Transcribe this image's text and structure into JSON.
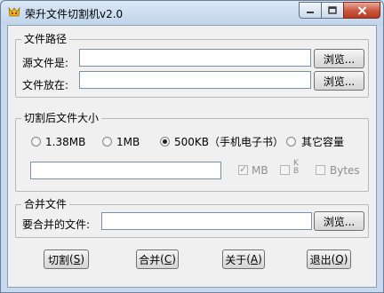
{
  "window": {
    "title": "荣升文件切割机v2.0"
  },
  "file_path": {
    "group_label": "文件路径",
    "source_label": "源文件是:",
    "source_value": "",
    "dest_label": "文件放在:",
    "dest_value": "",
    "browse_label": "浏览..."
  },
  "size": {
    "group_label": "切割后文件大小",
    "options": [
      {
        "label": "1.38MB",
        "checked": false
      },
      {
        "label": "1MB",
        "checked": false
      },
      {
        "label": "500KB（手机电子书）",
        "checked": true
      },
      {
        "label": "其它容量",
        "checked": false
      }
    ],
    "custom_value": "",
    "unit_mb": {
      "label": "MB",
      "checked": true
    },
    "unit_k": {
      "label": "K",
      "sub": "B",
      "checked": false
    },
    "unit_bytes": {
      "label": "Bytes",
      "checked": false
    }
  },
  "merge": {
    "group_label": "合并文件",
    "file_label": "要合并的文件:",
    "file_value": "",
    "browse_label": "浏览..."
  },
  "actions": {
    "split_label": "切割",
    "split_key": "S",
    "merge_label": "合并",
    "merge_key": "C",
    "about_label": "关于",
    "about_key": "A",
    "exit_label": "退出",
    "exit_key": "Q"
  }
}
